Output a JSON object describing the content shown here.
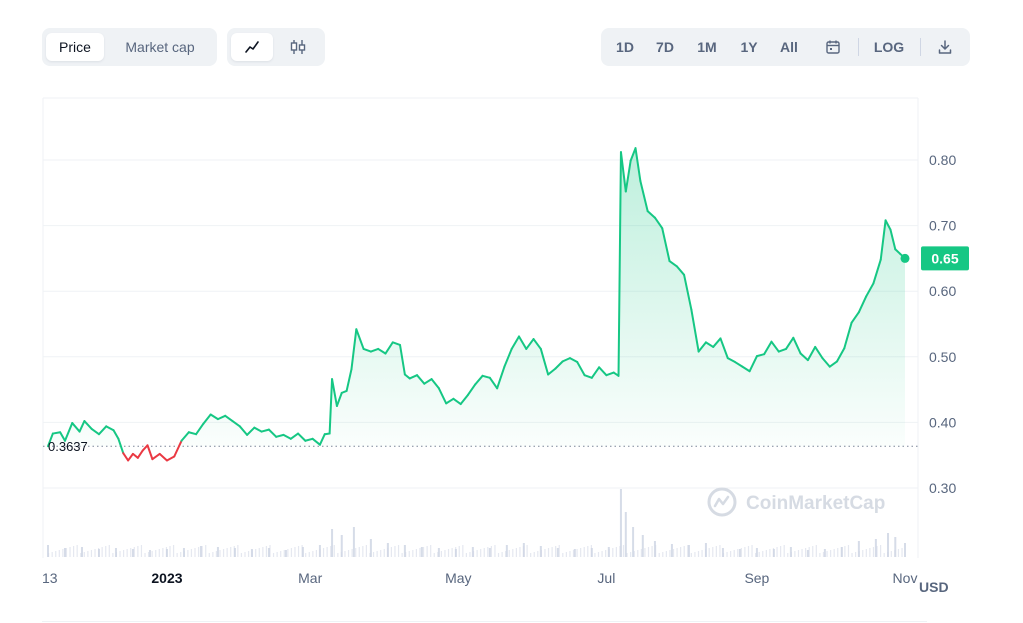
{
  "toolbar": {
    "price_label": "Price",
    "market_cap_label": "Market cap",
    "line_chart_icon": "line-chart-icon",
    "candlestick_icon": "candlestick-icon",
    "ranges": [
      "1D",
      "7D",
      "1M",
      "1Y",
      "All"
    ],
    "calendar_icon": "calendar-icon",
    "log_label": "LOG",
    "download_icon": "download-icon"
  },
  "watermark": "CoinMarketCap",
  "currency_label": "USD",
  "colors": {
    "up": "#16c784",
    "down": "#ea3943",
    "grid": "#eff2f5",
    "text": "#58667e",
    "volume": "#cfd6e4"
  },
  "chart_data": {
    "type": "line",
    "title": "",
    "xlabel": "",
    "ylabel": "",
    "ylim": [
      0.2,
      0.9
    ],
    "y_ticks": [
      "0.30",
      "0.40",
      "0.50",
      "0.60",
      "0.70",
      "0.80"
    ],
    "y_tick_values": [
      0.3,
      0.4,
      0.5,
      0.6,
      0.7,
      0.8
    ],
    "x_ticks": [
      "13",
      "2023",
      "Mar",
      "May",
      "Jul",
      "Sep",
      "Nov"
    ],
    "x_tick_dates": [
      "2022-11-13",
      "2023-01-01",
      "2023-03-01",
      "2023-05-01",
      "2023-07-01",
      "2023-09-01",
      "2023-11-01"
    ],
    "reference_value": 0.3637,
    "reference_label": "0.3637",
    "current_value": 0.65,
    "current_label": "0.65",
    "grid": true,
    "series": [
      {
        "points": [
          [
            "2022-11-13",
            0.3637
          ],
          [
            "2022-11-15",
            0.383
          ],
          [
            "2022-11-18",
            0.385
          ],
          [
            "2022-11-20",
            0.372
          ],
          [
            "2022-11-23",
            0.399
          ],
          [
            "2022-11-26",
            0.386
          ],
          [
            "2022-11-28",
            0.402
          ],
          [
            "2022-12-01",
            0.39
          ],
          [
            "2022-12-04",
            0.382
          ],
          [
            "2022-12-07",
            0.394
          ],
          [
            "2022-12-10",
            0.388
          ],
          [
            "2022-12-12",
            0.375
          ],
          [
            "2022-12-14",
            0.353
          ],
          [
            "2022-12-16",
            0.342
          ],
          [
            "2022-12-18",
            0.352
          ],
          [
            "2022-12-20",
            0.346
          ],
          [
            "2022-12-22",
            0.357
          ],
          [
            "2022-12-24",
            0.365
          ],
          [
            "2022-12-26",
            0.344
          ],
          [
            "2022-12-29",
            0.352
          ],
          [
            "2023-01-01",
            0.342
          ],
          [
            "2023-01-04",
            0.348
          ],
          [
            "2023-01-07",
            0.372
          ],
          [
            "2023-01-10",
            0.385
          ],
          [
            "2023-01-13",
            0.382
          ],
          [
            "2023-01-16",
            0.398
          ],
          [
            "2023-01-19",
            0.412
          ],
          [
            "2023-01-22",
            0.405
          ],
          [
            "2023-01-25",
            0.41
          ],
          [
            "2023-01-28",
            0.402
          ],
          [
            "2023-01-31",
            0.394
          ],
          [
            "2023-02-03",
            0.381
          ],
          [
            "2023-02-06",
            0.392
          ],
          [
            "2023-02-09",
            0.386
          ],
          [
            "2023-02-12",
            0.389
          ],
          [
            "2023-02-15",
            0.378
          ],
          [
            "2023-02-18",
            0.381
          ],
          [
            "2023-02-21",
            0.375
          ],
          [
            "2023-02-24",
            0.383
          ],
          [
            "2023-02-27",
            0.372
          ],
          [
            "2023-03-02",
            0.375
          ],
          [
            "2023-03-05",
            0.366
          ],
          [
            "2023-03-07",
            0.382
          ],
          [
            "2023-03-09",
            0.383
          ],
          [
            "2023-03-10",
            0.466
          ],
          [
            "2023-03-12",
            0.425
          ],
          [
            "2023-03-14",
            0.445
          ],
          [
            "2023-03-16",
            0.448
          ],
          [
            "2023-03-18",
            0.481
          ],
          [
            "2023-03-20",
            0.542
          ],
          [
            "2023-03-23",
            0.512
          ],
          [
            "2023-03-26",
            0.508
          ],
          [
            "2023-03-29",
            0.512
          ],
          [
            "2023-04-01",
            0.505
          ],
          [
            "2023-04-04",
            0.522
          ],
          [
            "2023-04-07",
            0.518
          ],
          [
            "2023-04-09",
            0.473
          ],
          [
            "2023-04-11",
            0.467
          ],
          [
            "2023-04-14",
            0.472
          ],
          [
            "2023-04-17",
            0.459
          ],
          [
            "2023-04-20",
            0.466
          ],
          [
            "2023-04-23",
            0.452
          ],
          [
            "2023-04-26",
            0.429
          ],
          [
            "2023-04-29",
            0.436
          ],
          [
            "2023-05-02",
            0.428
          ],
          [
            "2023-05-05",
            0.442
          ],
          [
            "2023-05-08",
            0.458
          ],
          [
            "2023-05-11",
            0.471
          ],
          [
            "2023-05-14",
            0.468
          ],
          [
            "2023-05-17",
            0.452
          ],
          [
            "2023-05-20",
            0.485
          ],
          [
            "2023-05-23",
            0.512
          ],
          [
            "2023-05-26",
            0.531
          ],
          [
            "2023-05-29",
            0.512
          ],
          [
            "2023-06-01",
            0.527
          ],
          [
            "2023-06-04",
            0.512
          ],
          [
            "2023-06-07",
            0.473
          ],
          [
            "2023-06-10",
            0.482
          ],
          [
            "2023-06-13",
            0.493
          ],
          [
            "2023-06-16",
            0.498
          ],
          [
            "2023-06-19",
            0.492
          ],
          [
            "2023-06-22",
            0.472
          ],
          [
            "2023-06-25",
            0.468
          ],
          [
            "2023-06-28",
            0.484
          ],
          [
            "2023-07-01",
            0.472
          ],
          [
            "2023-07-04",
            0.476
          ],
          [
            "2023-07-06",
            0.471
          ],
          [
            "2023-07-07",
            0.812
          ],
          [
            "2023-07-09",
            0.752
          ],
          [
            "2023-07-11",
            0.799
          ],
          [
            "2023-07-13",
            0.818
          ],
          [
            "2023-07-15",
            0.768
          ],
          [
            "2023-07-18",
            0.722
          ],
          [
            "2023-07-21",
            0.712
          ],
          [
            "2023-07-24",
            0.696
          ],
          [
            "2023-07-27",
            0.646
          ],
          [
            "2023-07-30",
            0.638
          ],
          [
            "2023-08-02",
            0.625
          ],
          [
            "2023-08-05",
            0.572
          ],
          [
            "2023-08-08",
            0.508
          ],
          [
            "2023-08-11",
            0.522
          ],
          [
            "2023-08-14",
            0.515
          ],
          [
            "2023-08-17",
            0.528
          ],
          [
            "2023-08-20",
            0.498
          ],
          [
            "2023-08-23",
            0.492
          ],
          [
            "2023-08-26",
            0.485
          ],
          [
            "2023-08-29",
            0.478
          ],
          [
            "2023-09-01",
            0.501
          ],
          [
            "2023-09-04",
            0.504
          ],
          [
            "2023-09-07",
            0.523
          ],
          [
            "2023-09-10",
            0.508
          ],
          [
            "2023-09-13",
            0.512
          ],
          [
            "2023-09-16",
            0.529
          ],
          [
            "2023-09-19",
            0.505
          ],
          [
            "2023-09-22",
            0.495
          ],
          [
            "2023-09-25",
            0.515
          ],
          [
            "2023-09-28",
            0.498
          ],
          [
            "2023-10-01",
            0.485
          ],
          [
            "2023-10-04",
            0.493
          ],
          [
            "2023-10-07",
            0.513
          ],
          [
            "2023-10-10",
            0.552
          ],
          [
            "2023-10-13",
            0.568
          ],
          [
            "2023-10-16",
            0.592
          ],
          [
            "2023-10-19",
            0.612
          ],
          [
            "2023-10-22",
            0.648
          ],
          [
            "2023-10-24",
            0.708
          ],
          [
            "2023-10-26",
            0.694
          ],
          [
            "2023-10-28",
            0.664
          ],
          [
            "2023-10-30",
            0.657
          ],
          [
            "2023-11-01",
            0.65
          ]
        ]
      }
    ],
    "volume": [
      [
        "2022-11-13",
        12
      ],
      [
        "2022-11-20",
        9
      ],
      [
        "2022-11-27",
        10
      ],
      [
        "2022-12-04",
        8
      ],
      [
        "2022-12-11",
        9
      ],
      [
        "2022-12-18",
        8
      ],
      [
        "2022-12-25",
        7
      ],
      [
        "2023-01-01",
        8
      ],
      [
        "2023-01-08",
        9
      ],
      [
        "2023-01-15",
        11
      ],
      [
        "2023-01-22",
        10
      ],
      [
        "2023-01-29",
        9
      ],
      [
        "2023-02-05",
        8
      ],
      [
        "2023-02-12",
        9
      ],
      [
        "2023-02-19",
        7
      ],
      [
        "2023-02-26",
        10
      ],
      [
        "2023-03-05",
        12
      ],
      [
        "2023-03-10",
        28
      ],
      [
        "2023-03-14",
        22
      ],
      [
        "2023-03-19",
        30
      ],
      [
        "2023-03-26",
        18
      ],
      [
        "2023-04-02",
        14
      ],
      [
        "2023-04-09",
        12
      ],
      [
        "2023-04-16",
        10
      ],
      [
        "2023-04-23",
        9
      ],
      [
        "2023-04-30",
        8
      ],
      [
        "2023-05-07",
        10
      ],
      [
        "2023-05-14",
        9
      ],
      [
        "2023-05-21",
        12
      ],
      [
        "2023-05-28",
        14
      ],
      [
        "2023-06-04",
        11
      ],
      [
        "2023-06-11",
        9
      ],
      [
        "2023-06-18",
        8
      ],
      [
        "2023-06-25",
        9
      ],
      [
        "2023-07-02",
        10
      ],
      [
        "2023-07-07",
        68
      ],
      [
        "2023-07-09",
        45
      ],
      [
        "2023-07-12",
        30
      ],
      [
        "2023-07-16",
        22
      ],
      [
        "2023-07-21",
        16
      ],
      [
        "2023-07-28",
        13
      ],
      [
        "2023-08-04",
        12
      ],
      [
        "2023-08-11",
        14
      ],
      [
        "2023-08-18",
        9
      ],
      [
        "2023-08-25",
        8
      ],
      [
        "2023-09-01",
        9
      ],
      [
        "2023-09-08",
        8
      ],
      [
        "2023-09-15",
        10
      ],
      [
        "2023-09-22",
        7
      ],
      [
        "2023-09-29",
        8
      ],
      [
        "2023-10-06",
        10
      ],
      [
        "2023-10-13",
        16
      ],
      [
        "2023-10-20",
        18
      ],
      [
        "2023-10-25",
        24
      ],
      [
        "2023-10-28",
        20
      ],
      [
        "2023-11-01",
        14
      ]
    ]
  }
}
